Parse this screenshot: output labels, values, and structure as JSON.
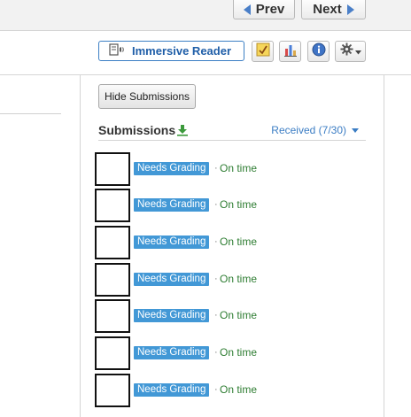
{
  "nav": {
    "prev_label": "Prev",
    "next_label": "Next"
  },
  "toolbar": {
    "immersive_reader_label": "Immersive Reader",
    "icons": [
      "speaker-book-icon",
      "rubric-icon",
      "bar-chart-icon",
      "info-icon",
      "gear-icon"
    ]
  },
  "submissions": {
    "hide_button_label": "Hide Submissions",
    "title": "Submissions",
    "received_label": "Received (7/30)",
    "separator": "·",
    "rows": [
      {
        "status": "Needs Grading",
        "timing": "On time"
      },
      {
        "status": "Needs Grading",
        "timing": "On time"
      },
      {
        "status": "Needs Grading",
        "timing": "On time"
      },
      {
        "status": "Needs Grading",
        "timing": "On time"
      },
      {
        "status": "Needs Grading",
        "timing": "On time"
      },
      {
        "status": "Needs Grading",
        "timing": "On time"
      },
      {
        "status": "Needs Grading",
        "timing": "On time"
      }
    ]
  },
  "colors": {
    "accent_blue": "#3b7dc4",
    "badge_blue": "#4298d6",
    "on_time_green": "#2e7d32"
  }
}
